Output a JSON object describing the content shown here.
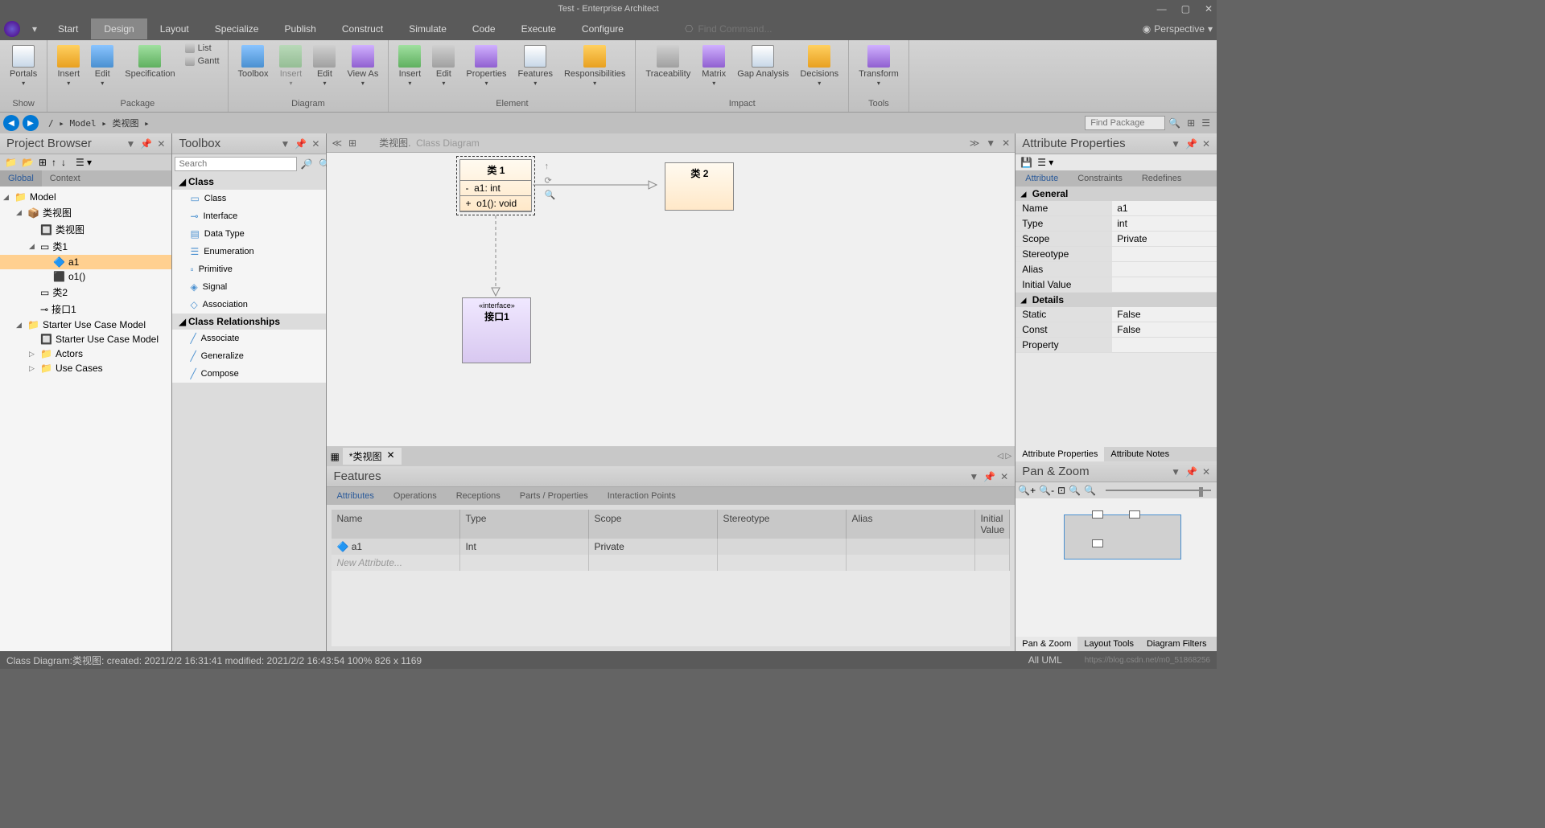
{
  "title": "Test - Enterprise Architect",
  "menus": [
    "Start",
    "Design",
    "Layout",
    "Specialize",
    "Publish",
    "Construct",
    "Simulate",
    "Code",
    "Execute",
    "Configure"
  ],
  "menu_active": "Design",
  "find_command": "Find Command...",
  "perspective": "Perspective",
  "ribbon": {
    "groups": [
      {
        "label": "Show",
        "buttons": [
          {
            "t": "Portals"
          }
        ]
      },
      {
        "label": "Package",
        "buttons": [
          {
            "t": "Insert"
          },
          {
            "t": "Edit"
          },
          {
            "t": "Specification"
          }
        ],
        "side": [
          "List",
          "Gantt"
        ]
      },
      {
        "label": "Diagram",
        "buttons": [
          {
            "t": "Toolbox"
          },
          {
            "t": "Insert",
            "dim": true
          },
          {
            "t": "Edit"
          },
          {
            "t": "View As"
          }
        ]
      },
      {
        "label": "Element",
        "buttons": [
          {
            "t": "Insert"
          },
          {
            "t": "Edit"
          },
          {
            "t": "Properties"
          },
          {
            "t": "Features"
          },
          {
            "t": "Responsibilities"
          }
        ]
      },
      {
        "label": "Impact",
        "buttons": [
          {
            "t": "Traceability"
          },
          {
            "t": "Matrix"
          },
          {
            "t": "Gap Analysis"
          },
          {
            "t": "Decisions"
          }
        ]
      },
      {
        "label": "Tools",
        "buttons": [
          {
            "t": "Transform"
          }
        ]
      }
    ]
  },
  "breadcrumb": "/  ▸  Model  ▸  类视图  ▸",
  "find_package": "Find Package",
  "project_browser": {
    "title": "Project Browser",
    "tabs": [
      "Global",
      "Context"
    ],
    "tree": [
      {
        "indent": 0,
        "caret": "◢",
        "icon": "📁",
        "text": "Model"
      },
      {
        "indent": 1,
        "caret": "◢",
        "icon": "📦",
        "text": "类视图"
      },
      {
        "indent": 2,
        "caret": "",
        "icon": "🔲",
        "text": "类视图"
      },
      {
        "indent": 2,
        "caret": "◢",
        "icon": "▭",
        "text": "类1"
      },
      {
        "indent": 3,
        "caret": "",
        "icon": "🔷",
        "text": "a1",
        "selected": true
      },
      {
        "indent": 3,
        "caret": "",
        "icon": "⬛",
        "text": "o1()"
      },
      {
        "indent": 2,
        "caret": "",
        "icon": "▭",
        "text": "类2"
      },
      {
        "indent": 2,
        "caret": "",
        "icon": "⊸",
        "text": "接口1"
      },
      {
        "indent": 1,
        "caret": "◢",
        "icon": "📁",
        "text": "Starter Use Case Model"
      },
      {
        "indent": 2,
        "caret": "",
        "icon": "🔲",
        "text": "Starter Use Case Model"
      },
      {
        "indent": 2,
        "caret": "▷",
        "icon": "📁",
        "text": "Actors"
      },
      {
        "indent": 2,
        "caret": "▷",
        "icon": "📁",
        "text": "Use Cases"
      }
    ]
  },
  "toolbox": {
    "title": "Toolbox",
    "search": "Search",
    "cat1": "Class",
    "items1": [
      "Class",
      "Interface",
      "Data Type",
      "Enumeration",
      "Primitive",
      "Signal",
      "Association"
    ],
    "cat2": "Class Relationships",
    "items2": [
      "Associate",
      "Generalize",
      "Compose"
    ]
  },
  "canvas": {
    "tab_text1": "类视图.",
    "tab_text2": "Class Diagram",
    "class1": {
      "name": "类 1",
      "attr": "a1: int",
      "op": "o1(): void"
    },
    "class2": {
      "name": "类 2"
    },
    "iface": {
      "stereo": "«interface»",
      "name": "接口1"
    },
    "doctab": "*类视图"
  },
  "features": {
    "title": "Features",
    "tabs": [
      "Attributes",
      "Operations",
      "Receptions",
      "Parts / Properties",
      "Interaction Points"
    ],
    "headers": [
      "Name",
      "Type",
      "Scope",
      "Stereotype",
      "Alias",
      "Initial Value"
    ],
    "row": {
      "name": "a1",
      "type": "Int",
      "scope": "Private",
      "stereo": "",
      "alias": "",
      "init": ""
    },
    "new": "New Attribute..."
  },
  "attr_props": {
    "title": "Attribute Properties",
    "tabs": [
      "Attribute",
      "Constraints",
      "Redefines"
    ],
    "general": "General",
    "details": "Details",
    "rows_general": [
      [
        "Name",
        "a1"
      ],
      [
        "Type",
        "int"
      ],
      [
        "Scope",
        "Private"
      ],
      [
        "Stereotype",
        ""
      ],
      [
        "Alias",
        ""
      ],
      [
        "Initial Value",
        ""
      ]
    ],
    "rows_details": [
      [
        "Static",
        "False"
      ],
      [
        "Const",
        "False"
      ],
      [
        "Property",
        ""
      ]
    ],
    "bottom_tabs": [
      "Attribute Properties",
      "Attribute Notes"
    ]
  },
  "pan_zoom": {
    "title": "Pan & Zoom",
    "tabs": [
      "Pan & Zoom",
      "Layout Tools",
      "Diagram Filters"
    ]
  },
  "status": {
    "left": "Class Diagram:类视图:   created: 2021/2/2 16:31:41   modified: 2021/2/2 16:43:54   100%    826 x 1169",
    "right": "All UML",
    "watermark": "https://blog.csdn.net/m0_51868256"
  }
}
